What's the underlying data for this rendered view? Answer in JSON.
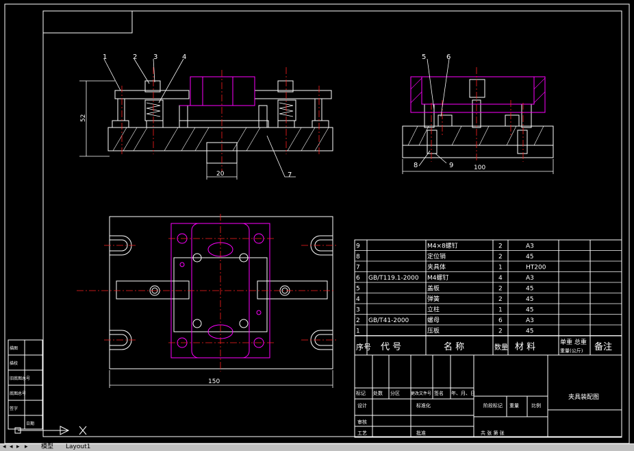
{
  "title_block": {
    "drawing_name": "夹具装配图"
  },
  "dims": {
    "height": "52",
    "width_bottom": "150",
    "width_side": "100",
    "slot": "20"
  },
  "leaders": [
    "1",
    "2",
    "3",
    "4",
    "5",
    "6",
    "7",
    "8",
    "9"
  ],
  "bom": [
    {
      "no": "9",
      "code": "",
      "name": "M4×8螺钉",
      "qty": "2",
      "mat": "A3"
    },
    {
      "no": "8",
      "code": "",
      "name": "定位销",
      "qty": "2",
      "mat": "45"
    },
    {
      "no": "7",
      "code": "",
      "name": "夹具体",
      "qty": "1",
      "mat": "HT200"
    },
    {
      "no": "6",
      "code": "GB/T119.1-2000",
      "name": "M4螺钉",
      "qty": "4",
      "mat": "A3"
    },
    {
      "no": "5",
      "code": "",
      "name": "盖板",
      "qty": "2",
      "mat": "45"
    },
    {
      "no": "4",
      "code": "",
      "name": "弹簧",
      "qty": "2",
      "mat": "45"
    },
    {
      "no": "3",
      "code": "",
      "name": "立柱",
      "qty": "1",
      "mat": "45"
    },
    {
      "no": "2",
      "code": "GB/T41-2000",
      "name": "螺母",
      "qty": "6",
      "mat": "A3"
    },
    {
      "no": "1",
      "code": "",
      "name": "压板",
      "qty": "2",
      "mat": "45"
    }
  ],
  "bom_header": {
    "no": "序号",
    "code": "代 号",
    "name": "名 称",
    "qty": "数量",
    "mat": "材 料",
    "weight": "单重 总重",
    "weight_unit": "重量(公斤)",
    "note": "备注"
  },
  "tb_labels": {
    "marks": [
      "标记",
      "处数",
      "分区",
      "更改文件号",
      "签名",
      "年、月、日"
    ],
    "design": "设计",
    "std": "标准化",
    "review": "审核",
    "process": "工艺",
    "approve": "批准",
    "stage": "阶段标记",
    "weight": "重量",
    "scale": "比例",
    "sheets": "共  张 第  张"
  },
  "left_block": [
    "描图",
    "描校",
    "旧底图总号",
    "底图总号",
    "签字",
    "日期"
  ],
  "tabs": [
    "模型",
    "Layout1"
  ]
}
